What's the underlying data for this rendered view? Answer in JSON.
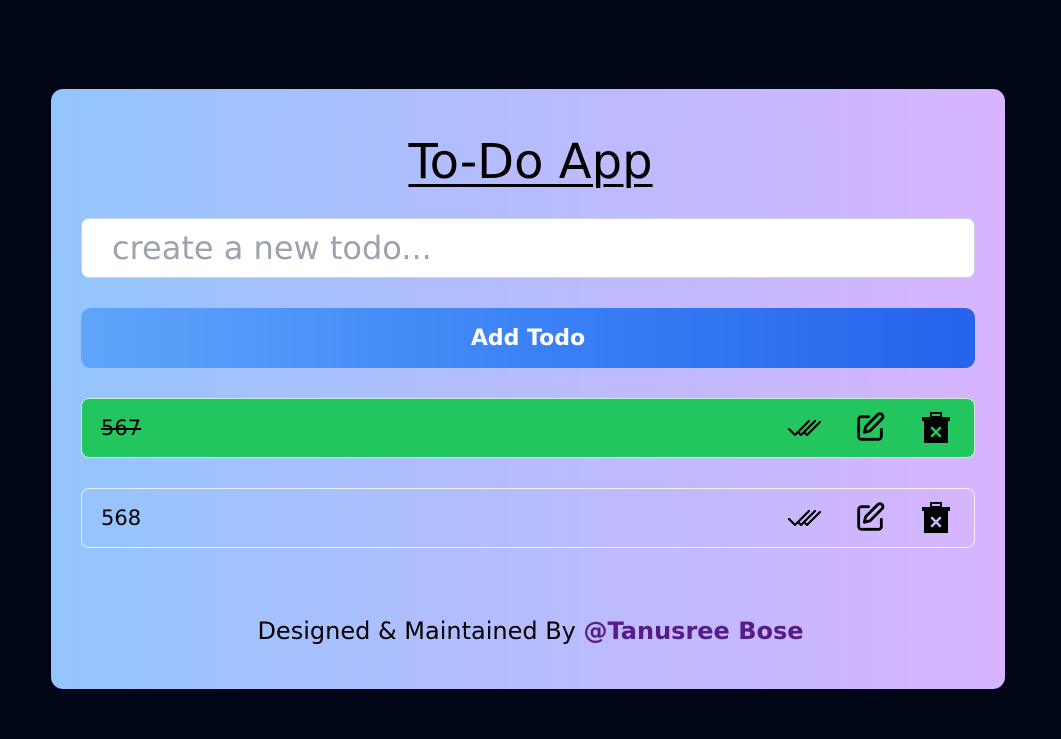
{
  "app": {
    "title": "To-Do App"
  },
  "input": {
    "value": "",
    "placeholder": "create a new todo..."
  },
  "add_button": {
    "label": "Add Todo"
  },
  "todos": [
    {
      "text": "567",
      "completed": true
    },
    {
      "text": "568",
      "completed": false
    }
  ],
  "icons": {
    "complete": "double-check-icon",
    "edit": "edit-icon",
    "delete": "trash-icon"
  },
  "footer": {
    "prefix": "Designed & Maintained By",
    "author": "@Tanusree Bose"
  },
  "colors": {
    "background": "#010616",
    "completed_item": "#22c55e",
    "button_start": "#60a5fa",
    "button_end": "#2563eb",
    "author_link": "#581c87"
  }
}
